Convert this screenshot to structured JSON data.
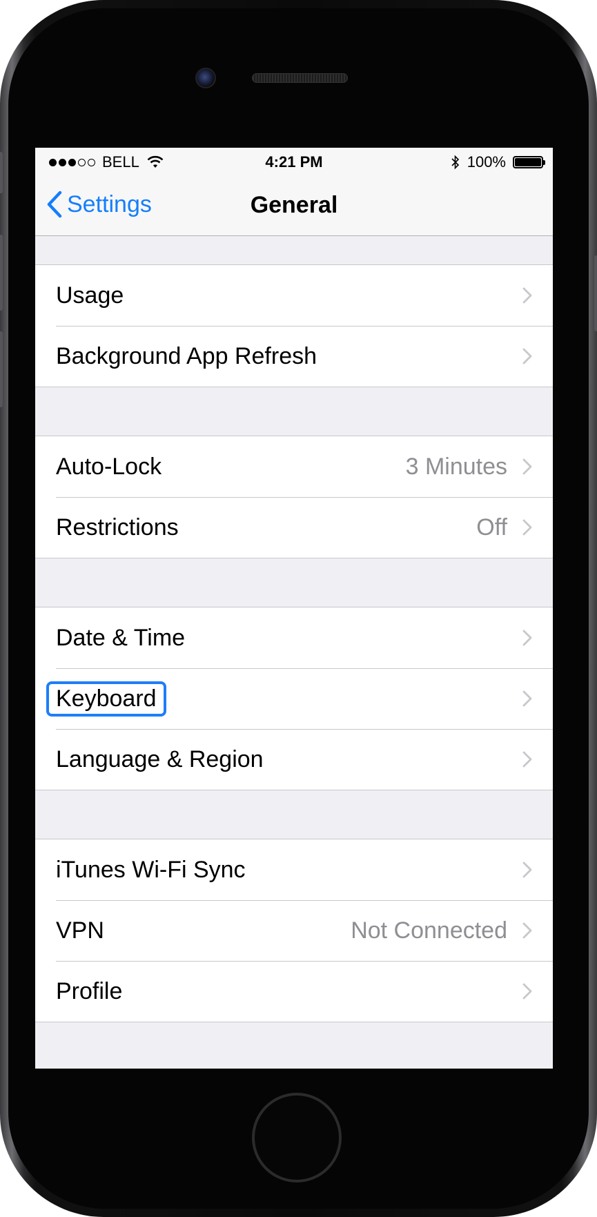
{
  "status_bar": {
    "carrier": "BELL",
    "time": "4:21 PM",
    "battery": "100%",
    "signal_bars_filled": 3,
    "signal_bars_total": 5,
    "battery_level": 1.0,
    "icons": [
      "wifi-icon",
      "bluetooth-icon",
      "battery-icon"
    ]
  },
  "nav": {
    "back_label": "Settings",
    "title": "General"
  },
  "groups": [
    [
      {
        "label": "Usage",
        "value": ""
      },
      {
        "label": "Background App Refresh",
        "value": ""
      }
    ],
    [
      {
        "label": "Auto-Lock",
        "value": "3 Minutes"
      },
      {
        "label": "Restrictions",
        "value": "Off"
      }
    ],
    [
      {
        "label": "Date & Time",
        "value": ""
      },
      {
        "label": "Keyboard",
        "value": "",
        "highlighted": true
      },
      {
        "label": "Language & Region",
        "value": ""
      }
    ],
    [
      {
        "label": "iTunes Wi-Fi Sync",
        "value": ""
      },
      {
        "label": "VPN",
        "value": "Not Connected"
      },
      {
        "label": "Profile",
        "value": ""
      }
    ]
  ],
  "colors": {
    "accent": "#157efb",
    "highlight_border": "#1e7ef7",
    "secondary_text": "#8e8e93",
    "grouped_background": "#efeff4"
  }
}
